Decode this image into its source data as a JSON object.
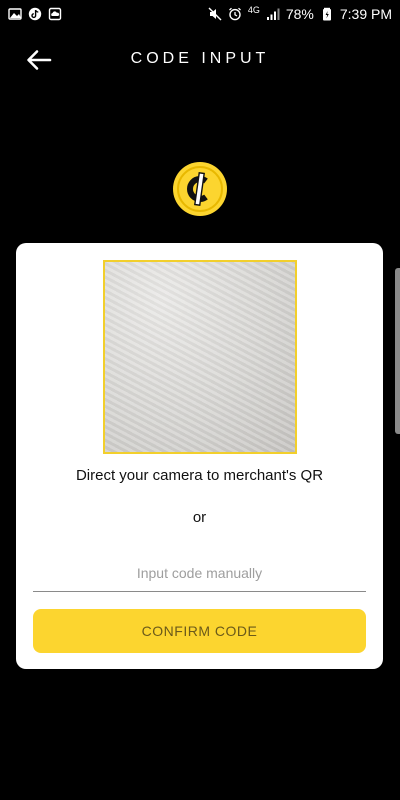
{
  "status_bar": {
    "battery_percent": "78%",
    "time": "7:39 PM",
    "network_label": "4G",
    "left_icons": [
      "gallery-icon",
      "tiktok-icon",
      "cloud-icon"
    ],
    "right_icons": [
      "mute-icon",
      "alarm-icon",
      "signal-icon",
      "battery-icon"
    ]
  },
  "header": {
    "title": "CODE INPUT"
  },
  "card": {
    "camera_instruction": "Direct your camera to merchant's QR",
    "or_text": "or",
    "input_placeholder": "Input code manually",
    "input_value": "",
    "confirm_label": "CONFIRM CODE"
  },
  "colors": {
    "background": "#000000",
    "accent_yellow": "#fcd52f",
    "card": "#ffffff",
    "frame_border": "#f2cf2c"
  }
}
